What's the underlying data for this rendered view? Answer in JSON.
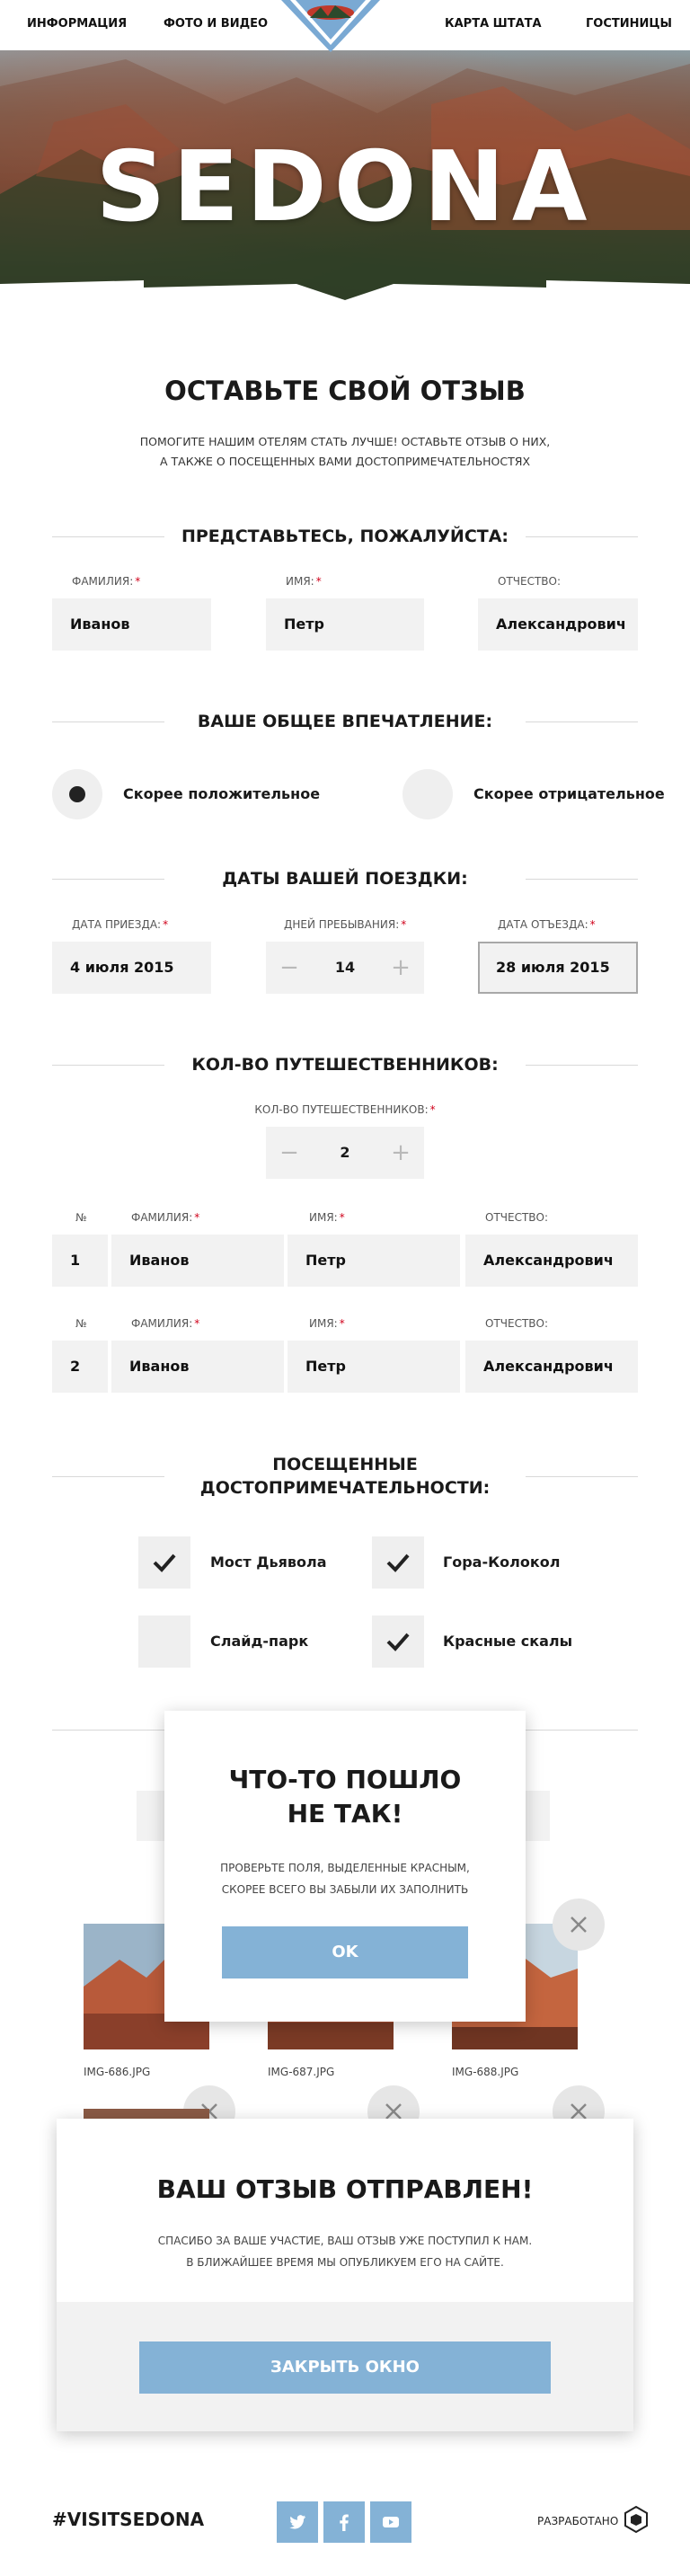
{
  "nav": {
    "info": "ИНФОРМАЦИЯ",
    "photo_video": "ФОТО И ВИДЕО",
    "map": "КАРТА ШТАТА",
    "hotels": "ГОСТИНИЦЫ"
  },
  "hero": {
    "title": "SEDONA"
  },
  "page": {
    "title": "ОСТАВЬТЕ СВОЙ ОТЗЫВ",
    "intro_line1": "ПОМОГИТЕ НАШИМ ОТЕЛЯМ СТАТЬ ЛУЧШЕ! ОСТАВЬТЕ ОТЗЫВ О НИХ,",
    "intro_line2": "А ТАКЖЕ О ПОСЕЩЕННЫХ ВАМИ ДОСТОПРИМЕЧАТЕЛЬНОСТЯХ"
  },
  "intro_section": {
    "title": "ПРЕДСТАВЬТЕСЬ, ПОЖАЛУЙСТА:",
    "surname_label": "ФАМИЛИЯ:",
    "surname_value": "Иванов",
    "name_label": "ИМЯ:",
    "name_value": "Петр",
    "patronymic_label": "ОТЧЕСТВО:",
    "patronymic_value": "Александрович",
    "required_mark": "*"
  },
  "impression": {
    "title": "ВАШЕ ОБЩЕЕ ВПЕЧАТЛЕНИЕ:",
    "positive": "Скорее положительное",
    "negative": "Скорее отрицательное",
    "selected": "positive"
  },
  "dates": {
    "title": "ДАТЫ ВАШЕЙ ПОЕЗДКИ:",
    "arrival_label": "ДАТА ПРИЕЗДА:",
    "arrival_value": "4 июля 2015",
    "days_label": "ДНЕЙ ПРЕБЫВАНИЯ:",
    "days_value": "14",
    "departure_label": "ДАТА ОТЪЕЗДА:",
    "departure_value": "28 июля 2015"
  },
  "travelers": {
    "title": "КОЛ-ВО ПУТЕШЕСТВЕННИКОВ:",
    "count_label": "КОЛ-ВО ПУТЕШЕСТВЕННИКОВ:",
    "count_value": "2",
    "col_num": "№",
    "col_surname": "ФАМИЛИЯ:",
    "col_name": "ИМЯ:",
    "col_patronymic": "ОТЧЕСТВО:",
    "rows": [
      {
        "num": "1",
        "surname": "Иванов",
        "name": "Петр",
        "patronymic": "Александрович"
      },
      {
        "num": "2",
        "surname": "Иванов",
        "name": "Петр",
        "patronymic": "Александрович"
      }
    ]
  },
  "sights": {
    "title_line1": "ПОСЕЩЕННЫЕ",
    "title_line2": "ДОСТОПРИМЕЧАТЕЛЬНОСТИ:",
    "items": [
      {
        "label": "Мост Дьявола",
        "checked": true
      },
      {
        "label": "Гора-Колокол",
        "checked": true
      },
      {
        "label": "Слайд-парк",
        "checked": false
      },
      {
        "label": "Красные скалы",
        "checked": true
      }
    ]
  },
  "photos": {
    "files": [
      "IMG-686.JPG",
      "IMG-687.JPG",
      "IMG-688.JPG"
    ]
  },
  "error_modal": {
    "title_line1": "ЧТО-ТО ПОШЛО",
    "title_line2": "НЕ ТАК!",
    "text_line1": "ПРОВЕРЬТЕ ПОЛЯ, ВЫДЕЛЕННЫЕ КРАСНЫМ,",
    "text_line2": "СКОРЕЕ ВСЕГО ВЫ ЗАБЫЛИ ИХ ЗАПОЛНИТЬ",
    "ok": "OK"
  },
  "success_modal": {
    "title": "ВАШ ОТЗЫВ ОТПРАВЛЕН!",
    "text_line1": "СПАСИБО ЗА ВАШЕ УЧАСТИЕ, ВАШ ОТЗЫВ УЖЕ ПОСТУПИЛ К НАМ.",
    "text_line2": "В БЛИЖАЙШЕЕ ВРЕМЯ МЫ ОПУБЛИКУЕМ ЕГО НА САЙТЕ.",
    "close": "ЗАКРЫТЬ ОКНО"
  },
  "footer": {
    "hashtag": "#VISITSEDONA",
    "made_by": "РАЗРАБОТАНО",
    "social": [
      "twitter-icon",
      "facebook-icon",
      "youtube-icon"
    ]
  },
  "colors": {
    "accent": "#84b2d6",
    "field_bg": "#f2f2f2",
    "required": "#d0021b",
    "logo_bg": "#7aa9d3",
    "logo_badge": "#c0392b"
  }
}
